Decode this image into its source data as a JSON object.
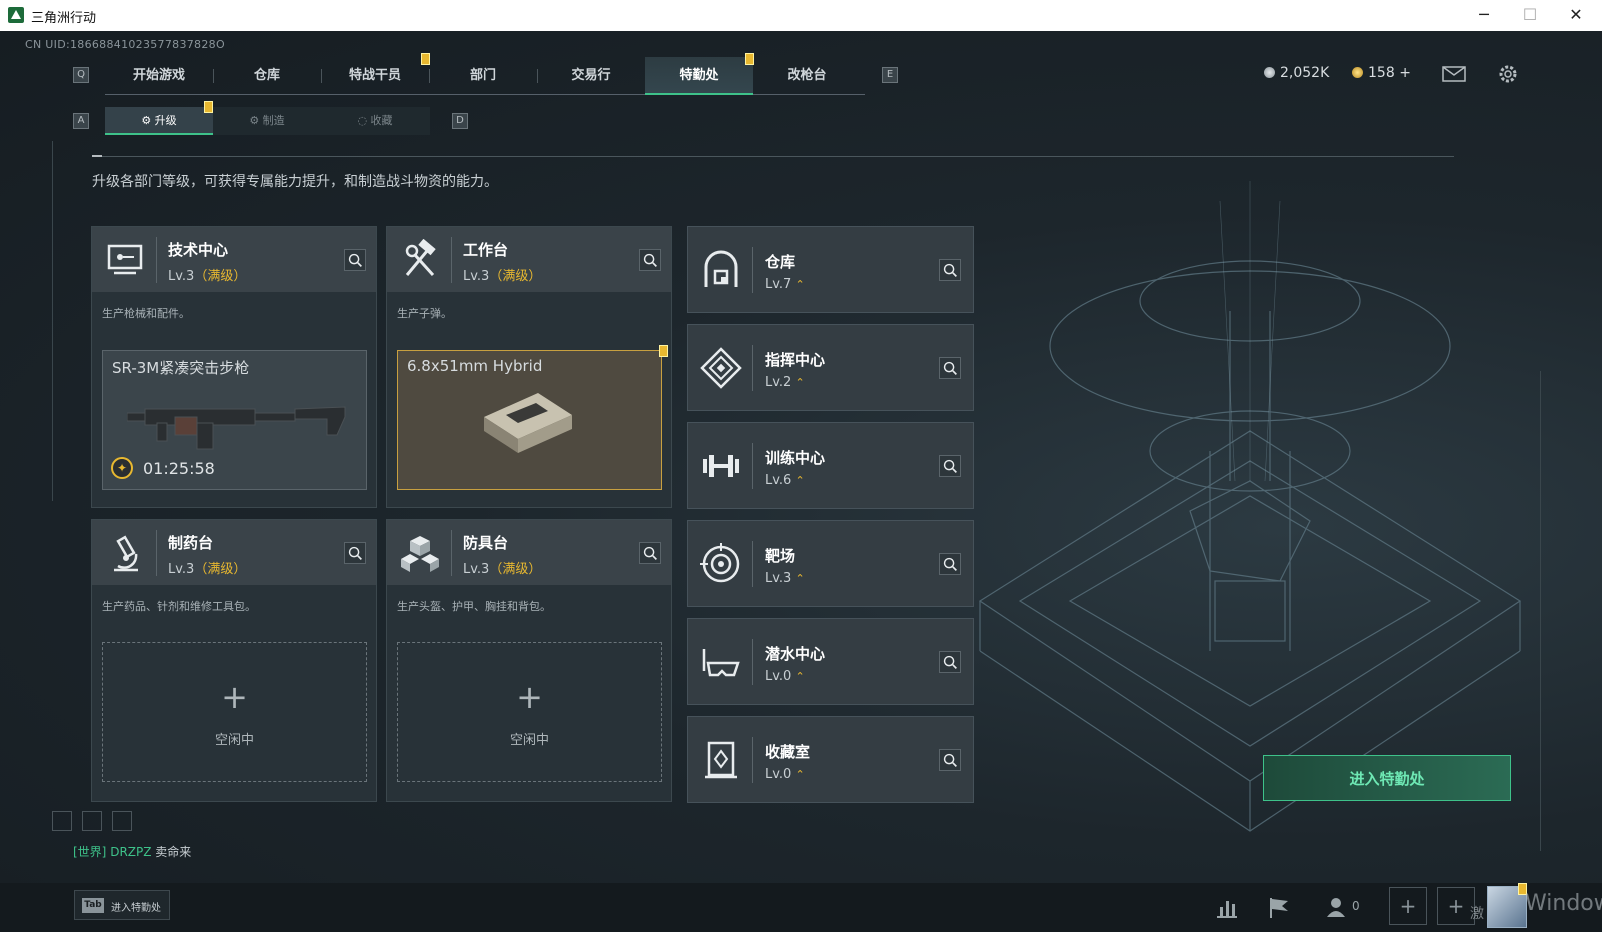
{
  "window": {
    "title": "三角洲行动"
  },
  "header": {
    "uid": "CN UID:18668841023577837828O"
  },
  "nav": {
    "key_left": "Q",
    "key_right": "E",
    "tabs": [
      {
        "label": "开始游戏"
      },
      {
        "label": "仓库"
      },
      {
        "label": "特战干员"
      },
      {
        "label": "部门"
      },
      {
        "label": "交易行"
      },
      {
        "label": "特勤处"
      },
      {
        "label": "改枪台"
      }
    ],
    "active": "特勤处"
  },
  "subnav": {
    "key_left": "A",
    "key_right": "D",
    "tabs": [
      {
        "label": "升级"
      },
      {
        "label": "制造"
      },
      {
        "label": "收藏"
      }
    ],
    "active": "升级"
  },
  "currency": {
    "gold_amount": "2,052K",
    "coupon_amount": "158",
    "add": "+"
  },
  "description": "升级各部门等级，可获得专属能力提升，和制造战斗物资的能力。",
  "workshops": [
    {
      "name": "技术中心",
      "level": "Lv.3",
      "max": "（满级）",
      "desc": "生产枪械和配件。",
      "icon": "computer-icon",
      "production": {
        "item": "SR-3M紧凑突击步枪",
        "timer": "01:25:58"
      }
    },
    {
      "name": "工作台",
      "level": "Lv.3",
      "max": "（满级）",
      "desc": "生产子弹。",
      "icon": "hammer-wrench-icon",
      "production": {
        "item": "6.8x51mm Hybrid"
      }
    },
    {
      "name": "制药台",
      "level": "Lv.3",
      "max": "（满级）",
      "desc": "生产药品、针剂和维修工具包。",
      "icon": "microscope-icon",
      "slot": {
        "plus": "+",
        "status": "空闲中"
      }
    },
    {
      "name": "防具台",
      "level": "Lv.3",
      "max": "（满级）",
      "desc": "生产头盔、护甲、胸挂和背包。",
      "icon": "cubes-icon",
      "slot": {
        "plus": "+",
        "status": "空闲中"
      }
    }
  ],
  "facilities": [
    {
      "name": "仓库",
      "level": "Lv.7",
      "icon": "vault-icon"
    },
    {
      "name": "指挥中心",
      "level": "Lv.2",
      "icon": "command-diamond-icon"
    },
    {
      "name": "训练中心",
      "level": "Lv.6",
      "icon": "dumbbell-icon"
    },
    {
      "name": "靶场",
      "level": "Lv.3",
      "icon": "target-icon"
    },
    {
      "name": "潜水中心",
      "level": "Lv.0",
      "icon": "diving-mask-icon"
    },
    {
      "name": "收藏室",
      "level": "Lv.0",
      "icon": "collection-icon"
    }
  ],
  "up_arrow": "⌃",
  "enter_button": "进入特勤处",
  "chat": {
    "channel": "[世界]",
    "user": "DRZPZ",
    "message": "卖命来"
  },
  "bottom": {
    "tab_key": "Tab",
    "tab_label": "进入特勤处",
    "friends_count": "0",
    "watermark": "Windows",
    "watermark_prefix": "激"
  },
  "colors": {
    "accent_green": "#3ec28a",
    "gold": "#e8b830",
    "panel": "#283238"
  }
}
